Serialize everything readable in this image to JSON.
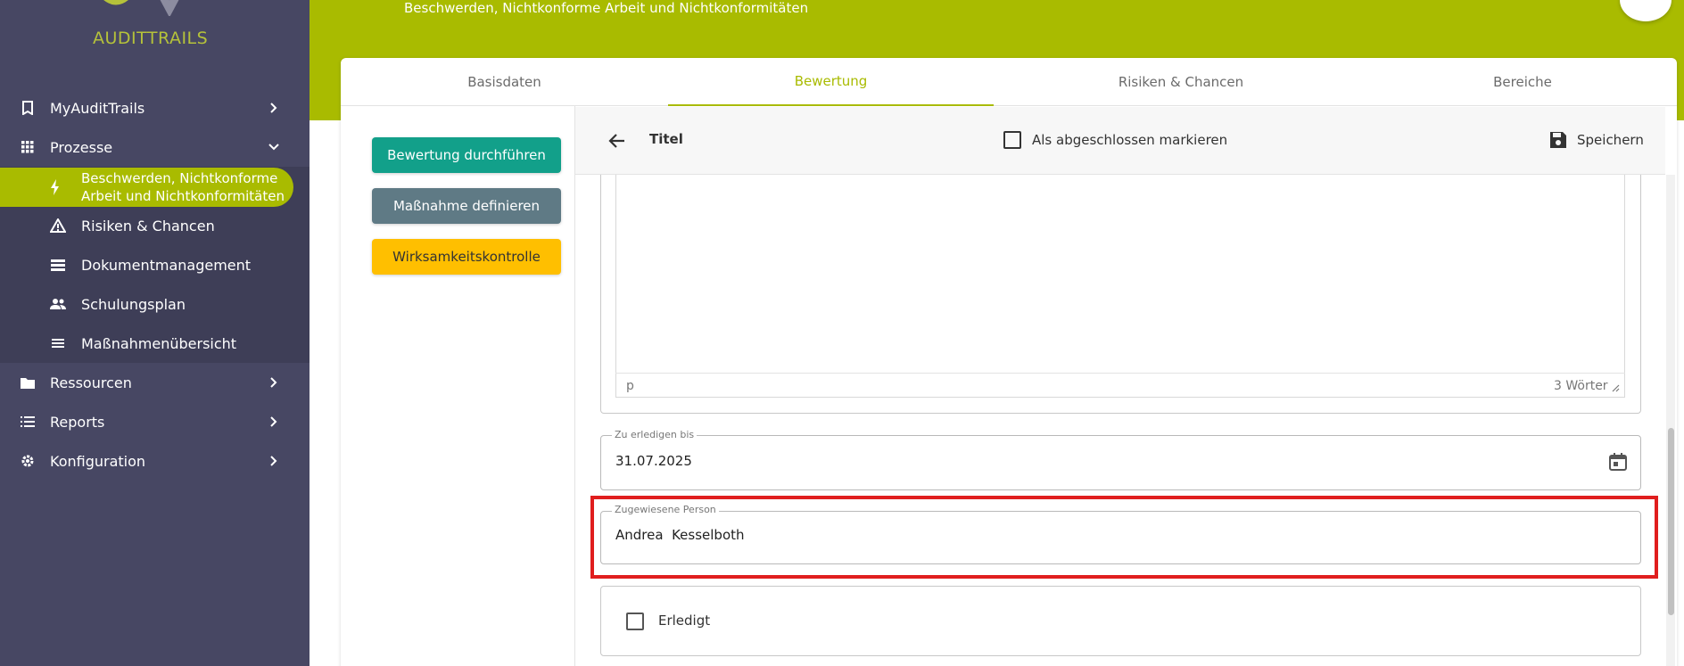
{
  "app": {
    "logo_text": "AUDITTRAILS",
    "colors": {
      "brand": "#a9bb00",
      "sidebar": "#474763",
      "teal": "#12a08a",
      "slate": "#5f7a85",
      "amber": "#ffbf00",
      "highlight": "#e01e1e"
    }
  },
  "sidebar": {
    "items": [
      {
        "label": "MyAuditTrails",
        "icon": "bookmark-icon"
      },
      {
        "label": "Prozesse",
        "icon": "grid-icon"
      },
      {
        "label": "Beschwerden, Nichtkonforme",
        "label2": "Arbeit und Nichtkonformitäten",
        "icon": "bolt-icon"
      },
      {
        "label": "Risiken & Chancen",
        "icon": "warning-icon"
      },
      {
        "label": "Dokumentmanagement",
        "icon": "list-icon"
      },
      {
        "label": "Schulungsplan",
        "icon": "people-icon"
      },
      {
        "label": "Maßnahmenübersicht",
        "icon": "lines-icon"
      },
      {
        "label": "Ressourcen",
        "icon": "folder-icon"
      },
      {
        "label": "Reports",
        "icon": "list-icon"
      },
      {
        "label": "Konfiguration",
        "icon": "gear-icon"
      }
    ]
  },
  "header": {
    "title": "Beschwerden, Nichtkonforme Arbeit und Nichtkonformitäten"
  },
  "tabs": [
    "Basisdaten",
    "Bewertung",
    "Risiken & Chancen",
    "Bereiche"
  ],
  "actions": {
    "evaluate": "Bewertung durchführen",
    "define": "Maßnahme definieren",
    "control": "Wirksamkeitskontrolle"
  },
  "toolbar": {
    "title": "Titel",
    "mark_done": "Als abgeschlossen markieren",
    "save": "Speichern"
  },
  "editor": {
    "path": "p",
    "word_count": "3 Wörter"
  },
  "fields": {
    "due_label": "Zu erledigen bis",
    "due_value": "31.07.2025",
    "assignee_label": "Zugewiesene Person",
    "assignee_value": "Andrea  Kesselboth",
    "done_label": "Erledigt"
  }
}
